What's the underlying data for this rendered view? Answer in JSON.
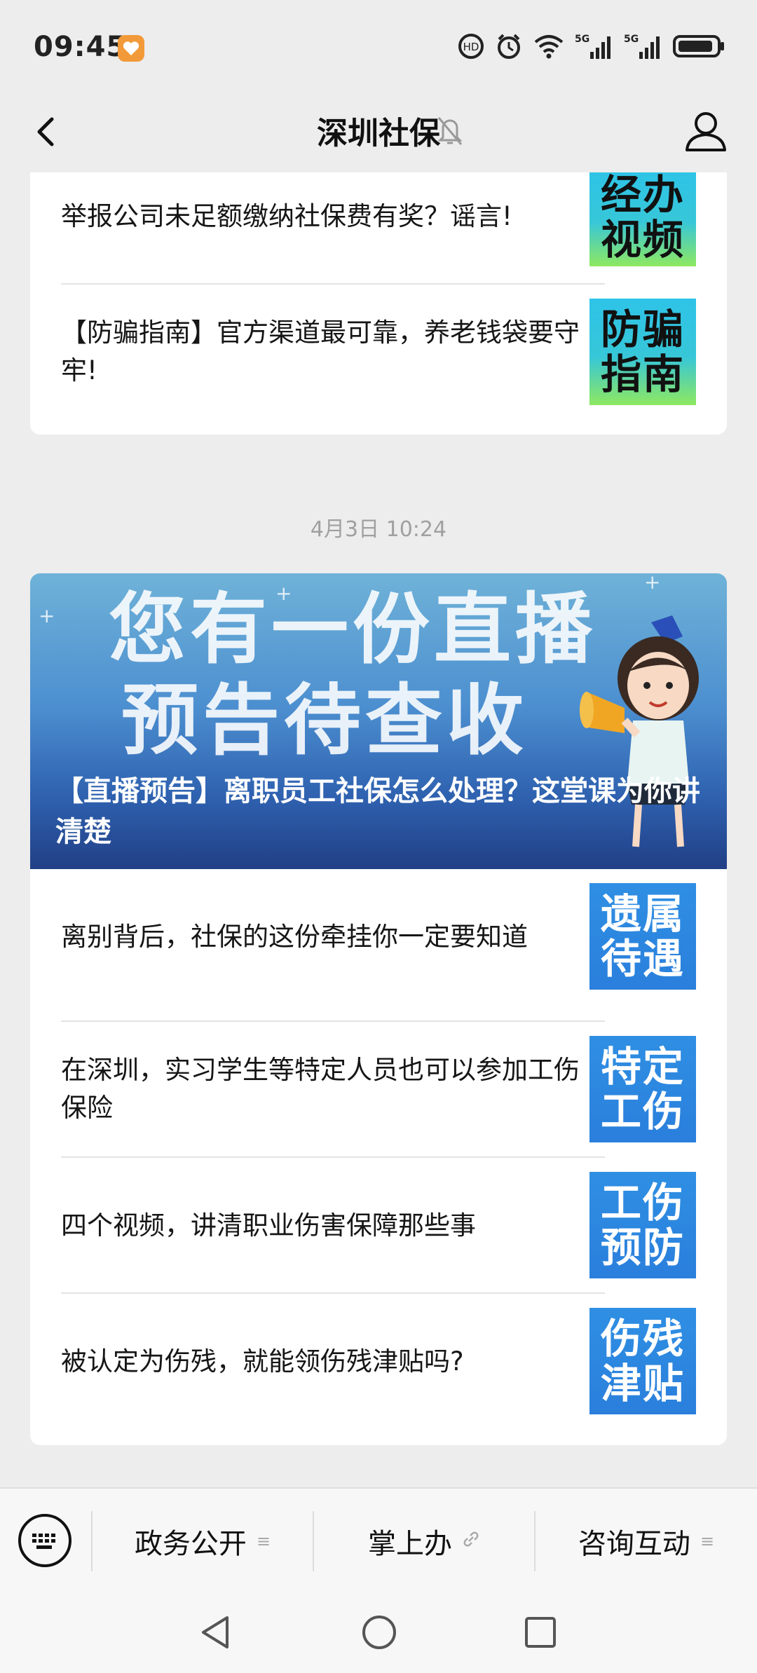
{
  "status_bar": {
    "time": "09:45",
    "icons": [
      "hd-icon",
      "alarm-icon",
      "wifi-icon",
      "signal-5g-icon",
      "signal-5g-icon",
      "battery-icon"
    ],
    "network1": "5G",
    "network2": "5G"
  },
  "nav": {
    "title": "深圳社保",
    "icons": [
      "back-icon",
      "mute-bell-icon",
      "profile-icon"
    ]
  },
  "card1": {
    "items": [
      {
        "title": "举报公司未足额缴纳社保费有奖？谣言!",
        "thumb_line1": "经办",
        "thumb_line2": "视频"
      },
      {
        "title": "【防骗指南】官方渠道最可靠，养老钱袋要守牢!",
        "thumb_line1": "防骗",
        "thumb_line2": "指南"
      }
    ]
  },
  "timestamp": "4月3日 10:24",
  "card2": {
    "banner": {
      "big_line1": "您有一份直播",
      "big_line2": "预告待查收",
      "title": "【直播预告】离职员工社保怎么处理？这堂课为你讲清楚"
    },
    "items": [
      {
        "title": "离别背后，社保的这份牵挂你一定要知道",
        "thumb_line1": "遗属",
        "thumb_line2": "待遇"
      },
      {
        "title": "在深圳，实习学生等特定人员也可以参加工伤保险",
        "thumb_line1": "特定",
        "thumb_line2": "工伤"
      },
      {
        "title": "四个视频，讲清职业伤害保障那些事",
        "thumb_line1": "工伤",
        "thumb_line2": "预防"
      },
      {
        "title": "被认定为伤残，就能领伤残津贴吗?",
        "thumb_line1": "伤残",
        "thumb_line2": "津贴"
      }
    ]
  },
  "menu": {
    "items": [
      {
        "label": "政务公开",
        "icon": "menu-lines-icon"
      },
      {
        "label": "掌上办",
        "icon": "link-icon"
      },
      {
        "label": "咨询互动",
        "icon": "menu-lines-icon"
      }
    ],
    "keyboard_icon": "keyboard-icon"
  },
  "system_nav": [
    "back-triangle-icon",
    "home-circle-icon",
    "recents-square-icon"
  ]
}
